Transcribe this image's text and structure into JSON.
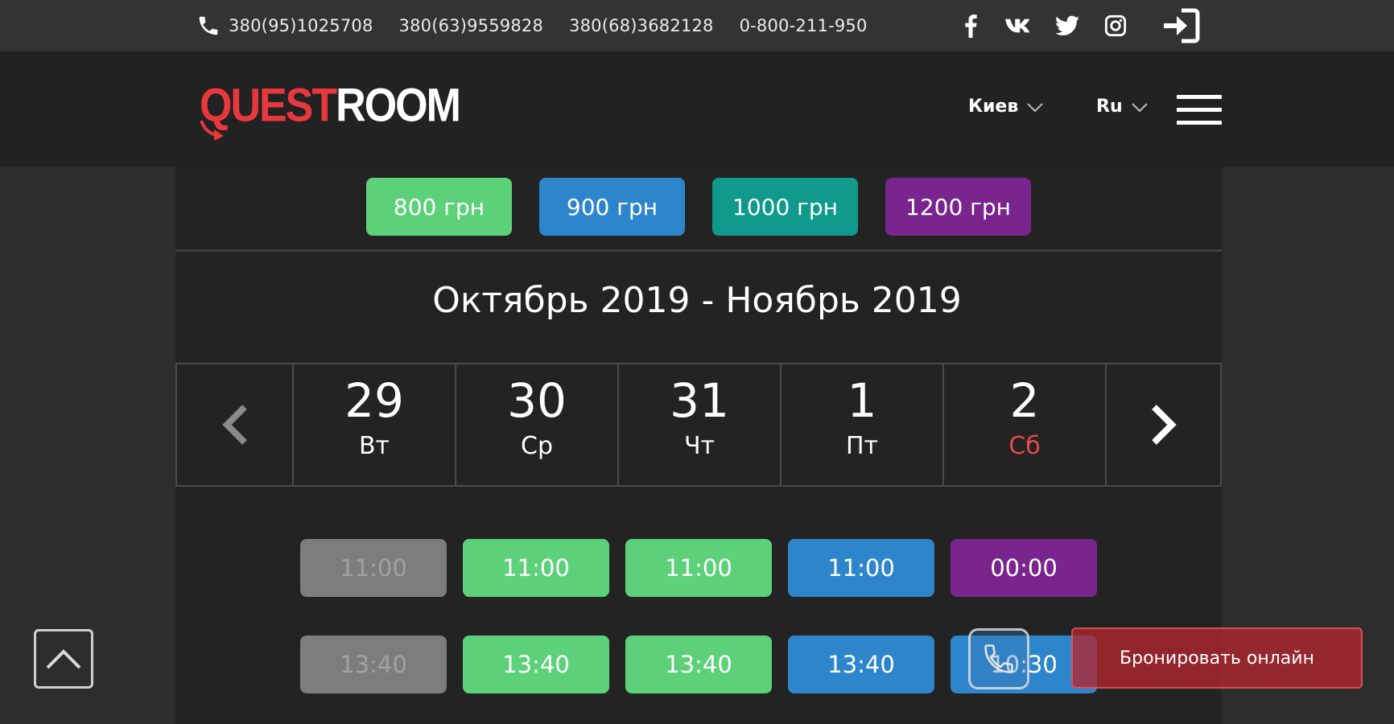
{
  "topbar": {
    "phones": [
      "380(95)1025708",
      "380(63)9559828",
      "380(68)3682128",
      "0-800-211-950"
    ],
    "social": [
      {
        "icon": "facebook-icon",
        "glyph": "f"
      },
      {
        "icon": "vk-icon",
        "glyph": "vk"
      },
      {
        "icon": "twitter-icon",
        "glyph": "twitter"
      },
      {
        "icon": "instagram-icon",
        "glyph": "instagram"
      }
    ]
  },
  "header": {
    "logo_part1": "QUEST",
    "logo_part2": "ROOM",
    "city": "Киев",
    "lang": "Ru"
  },
  "prices": [
    {
      "label": "800 грн",
      "color": "#5dd17a"
    },
    {
      "label": "900 грн",
      "color": "#2d86cc"
    },
    {
      "label": "1000 грн",
      "color": "#0f9a8c"
    },
    {
      "label": "1200 грн",
      "color": "#7a248d"
    }
  ],
  "calendar": {
    "month_title": "Октябрь 2019 - Ноябрь 2019",
    "days": [
      {
        "num": "29",
        "weekday": "Вт",
        "weekend": false
      },
      {
        "num": "30",
        "weekday": "Ср",
        "weekend": false
      },
      {
        "num": "31",
        "weekday": "Чт",
        "weekend": false
      },
      {
        "num": "1",
        "weekday": "Пт",
        "weekend": false
      },
      {
        "num": "2",
        "weekday": "Сб",
        "weekend": true
      }
    ]
  },
  "slots": [
    [
      {
        "time": "11:00",
        "status": "gray"
      },
      {
        "time": "11:00",
        "status": "green"
      },
      {
        "time": "11:00",
        "status": "green"
      },
      {
        "time": "11:00",
        "status": "blue"
      },
      {
        "time": "00:00",
        "status": "purple"
      }
    ],
    [
      {
        "time": "13:40",
        "status": "gray"
      },
      {
        "time": "13:40",
        "status": "green"
      },
      {
        "time": "13:40",
        "status": "green"
      },
      {
        "time": "13:40",
        "status": "blue"
      },
      {
        "time": "10:30",
        "status": "blue"
      }
    ]
  ],
  "book_button": "Бронировать онлайн"
}
